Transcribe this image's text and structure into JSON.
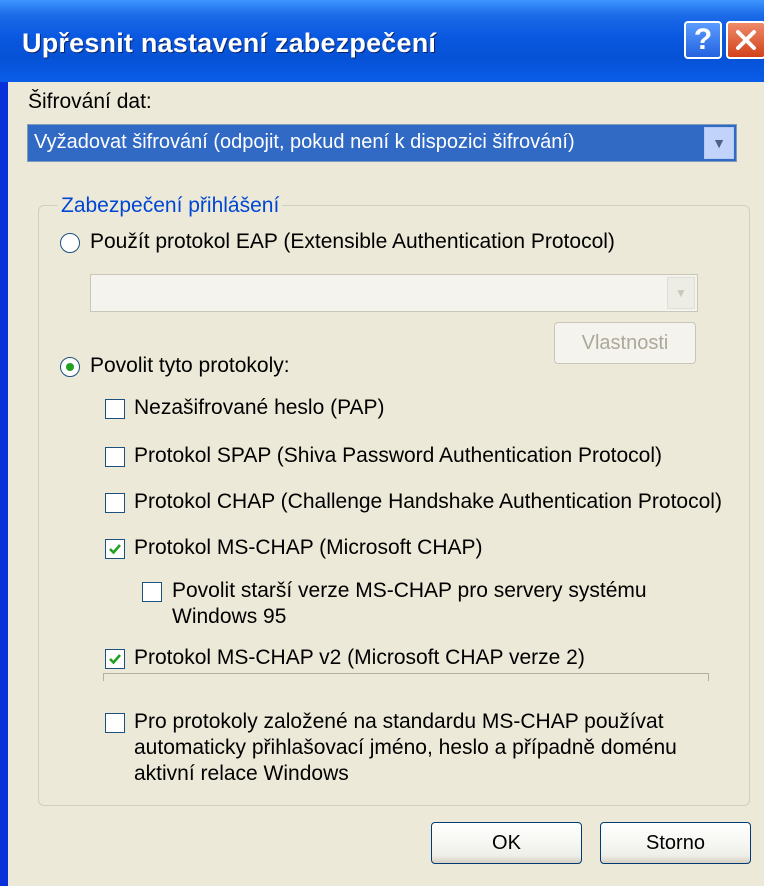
{
  "window": {
    "title": "Upřesnit nastavení zabezpečení",
    "help_label": "?",
    "close_label": "×"
  },
  "encryption": {
    "label": "Šifrování dat:",
    "selected": "Vyžadovat šifrování (odpojit, pokud není k dispozici šifrování)"
  },
  "logon_security": {
    "title": "Zabezpečení přihlášení",
    "eap_radio": {
      "label": "Použít protokol EAP (Extensible Authentication Protocol)",
      "selected": false
    },
    "eap_combo": {
      "value": "",
      "enabled": false
    },
    "properties_button": {
      "label": "Vlastnosti",
      "enabled": false
    },
    "allow_radio": {
      "label": "Povolit tyto protokoly:",
      "selected": true
    },
    "protocols": [
      {
        "label": "Nezašifrované heslo (PAP)",
        "checked": false
      },
      {
        "label": "Protokol SPAP (Shiva Password Authentication Protocol)",
        "checked": false
      },
      {
        "label": "Protokol CHAP (Challenge Handshake Authentication Protocol)",
        "checked": false
      },
      {
        "label": "Protokol MS-CHAP (Microsoft CHAP)",
        "checked": true
      }
    ],
    "mschap_legacy": {
      "line1": "Povolit starší verze MS-CHAP pro servery systému",
      "line2": "Windows 95",
      "checked": false
    },
    "mschap_v2": {
      "label": "Protokol MS-CHAP v2 (Microsoft CHAP verze 2)",
      "checked": true
    },
    "auto_logon": {
      "line1": "Pro protokoly založené na standardu MS-CHAP používat",
      "line2": "automaticky přihlašovací jméno, heslo a případně doménu",
      "line3": "aktivní relace Windows",
      "checked": false
    }
  },
  "buttons": {
    "ok": "OK",
    "cancel": "Storno"
  },
  "colors": {
    "titlebar": "#0a58e0",
    "selection": "#316ac5",
    "group_title": "#0046d5",
    "radio_dot": "#21a121",
    "checkmark": "#21a121"
  }
}
